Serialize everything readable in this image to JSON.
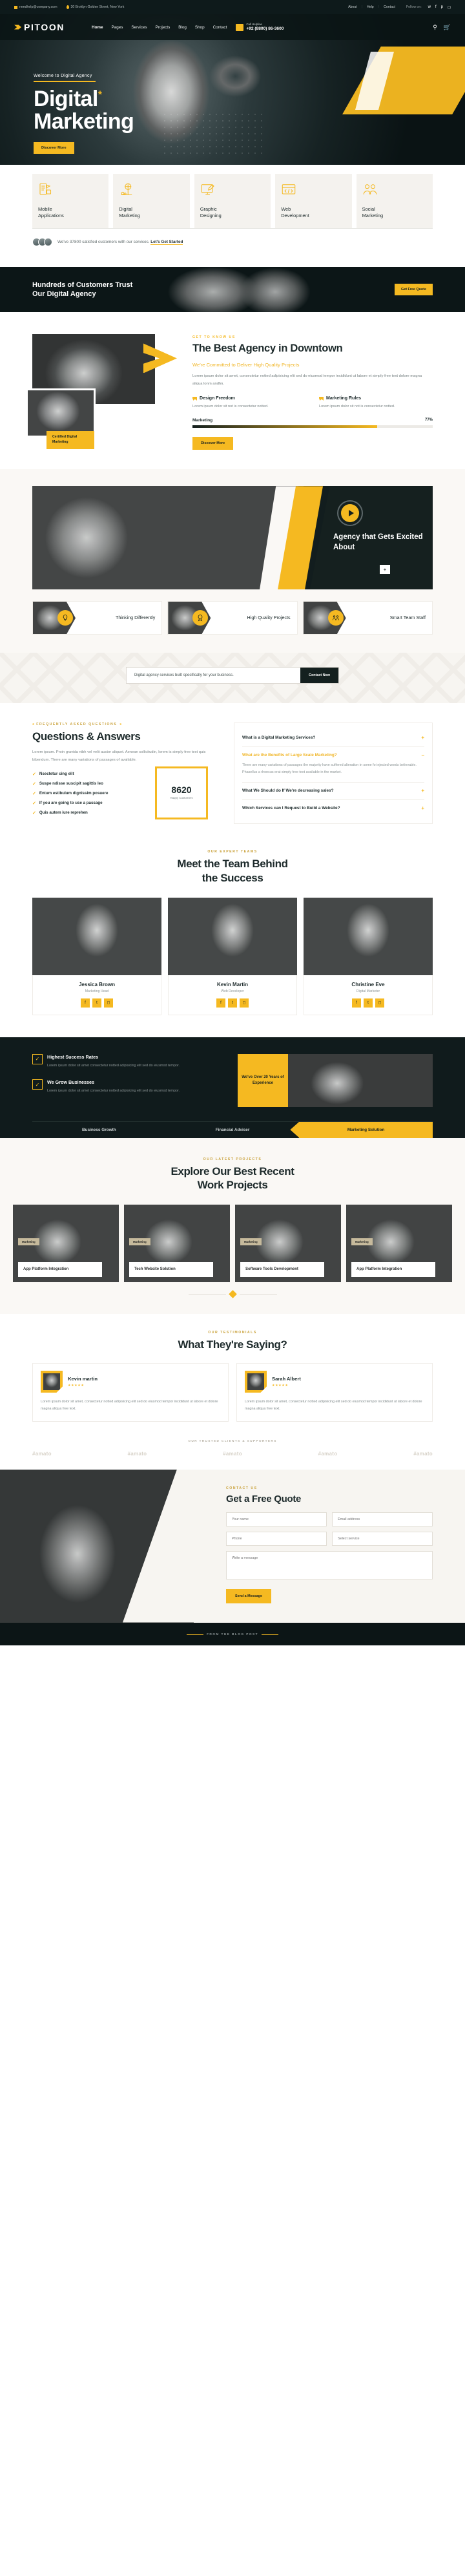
{
  "topbar": {
    "email": "needhelp@company.com",
    "address": "30 Broklyn Golden Street, New York",
    "links": [
      "About",
      "Help",
      "Contact"
    ],
    "follow_label": "Follow on:",
    "socials": [
      "twitter-icon",
      "facebook-icon",
      "pinterest-icon",
      "instagram-icon"
    ]
  },
  "header": {
    "logo": "PITOON",
    "nav": [
      "Home",
      "Pages",
      "Services",
      "Projects",
      "Blog",
      "Shop",
      "Contact"
    ],
    "helpline_label": "Call Helpline",
    "helpline_number": "+92 (8800) 86-3600"
  },
  "hero": {
    "superheading": "Welcome to Digital Agency",
    "title_line1": "Digital",
    "title_line2": "Marketing",
    "star": "*",
    "button": "Discover More"
  },
  "services": [
    {
      "name": "Mobile\nApplications",
      "icon": "mobile-app-icon"
    },
    {
      "name": "Digital\nMarketing",
      "icon": "digital-marketing-icon"
    },
    {
      "name": "Graphic\nDesigning",
      "icon": "graphic-design-icon"
    },
    {
      "name": "Web\nDevelopment",
      "icon": "web-development-icon"
    },
    {
      "name": "Social\nMarketing",
      "icon": "social-marketing-icon"
    }
  ],
  "satisfied": {
    "text": "We've 37800 satisfied customers with our services.",
    "link": "Let's Get Started"
  },
  "trust": {
    "heading": "Hundreds of Customers Trust\nOur Digital Agency",
    "button": "Get Free Quote"
  },
  "agency": {
    "kicker": "GET TO KNOW US",
    "heading": "The Best Agency in Downtown",
    "subheading": "We're Committed to Deliver High Quality Projects",
    "paragraph": "Lorem ipsum dolor sit amet, consectetur notted adipisicing elit sed do eiusmod tempor incididunt ut labore et simply free text dolore magna aliqua lonm andhn.",
    "features": [
      {
        "title": "Design Freedom",
        "text": "Lorem ipsum dolor sit not is consectetur notted."
      },
      {
        "title": "Marketing Rules",
        "text": "Lorem ipsum dolor sit not is consectetur notted."
      }
    ],
    "skill_label": "Marketing",
    "skill_value": "77%",
    "skill_pct": 77,
    "badge": "Certified Digital Marketing",
    "button": "Discover More"
  },
  "video": {
    "heading": "Agency that Gets Excited About",
    "play_icon": "play-icon",
    "plus": "+"
  },
  "features3": [
    {
      "title": "Thinking Differently",
      "icon": "lightbulb-icon"
    },
    {
      "title": "High Quality Projects",
      "icon": "badge-icon"
    },
    {
      "title": "Smart Team Staff",
      "icon": "team-icon"
    }
  ],
  "cta": {
    "text": "Digital agency services built specifically for your business.",
    "button": "Contact Now"
  },
  "faq": {
    "kicker": "FREQUENTLY ASKED QUESTIONS",
    "heading": "Questions & Answers",
    "paragraph": "Lorem ipsum. Proin gravida nibh vel velit auctor aliquet. Aenean sollicitudin, lorem is simply free text quis bibendum. There are many variations of passages of available.",
    "bullets": [
      "Nsectetur cing elit",
      "Suspe ndisse suscipit sagittis leo",
      "Entum estibulum dignissim posuere",
      "If you are going to use a passage",
      "Quis autem iure reprehen"
    ],
    "counter_number": "8620",
    "counter_label": "Happy Customers",
    "items": [
      {
        "q": "What is a Digital Marketing Services?",
        "a": "",
        "open": false
      },
      {
        "q": "What are the Benefits of Large Scale Marketing?",
        "a": "There are many variations of passages the majority have suffered alteration in some fo injected words believable. Phasellus a rhoncus erat simply free text available in the market.",
        "open": true
      },
      {
        "q": "What We Should do If We're decreasing sales?",
        "a": "",
        "open": false
      },
      {
        "q": "Which Services can I Request to Build a Website?",
        "a": "",
        "open": false
      }
    ]
  },
  "team": {
    "kicker": "OUR EXPERT TEAMS",
    "heading": "Meet the Team Behind\nthe Success",
    "members": [
      {
        "name": "Jessica Brown",
        "role": "Marketing Head",
        "socials": [
          "facebook-icon",
          "twitter-icon",
          "instagram-icon"
        ]
      },
      {
        "name": "Kevin Martin",
        "role": "Web Developer",
        "socials": [
          "facebook-icon",
          "twitter-icon",
          "instagram-icon"
        ]
      },
      {
        "name": "Christine Eve",
        "role": "Digital Marketer",
        "socials": [
          "facebook-icon",
          "twitter-icon",
          "instagram-icon"
        ]
      }
    ]
  },
  "success": {
    "items": [
      {
        "title": "Highest Success Rates",
        "text": "Lorem ipsum dolor sit amet consectetur notted adipisicing elit sed do eiusmod tempor."
      },
      {
        "title": "We Grow Businesses",
        "text": "Lorem ipsum dolor sit amet consectetur notted adipisicing elit sed do eiusmod tempor."
      }
    ],
    "badge": "We've Over 20 Years of Experience",
    "tabs": [
      "Business Growth",
      "Financial Adviser",
      "Marketing Solution"
    ],
    "active_tab": "Marketing Solution"
  },
  "projects": {
    "kicker": "OUR LATEST PROJECTS",
    "heading": "Explore Our Best Recent\nWork Projects",
    "items": [
      {
        "tag": "Marketing",
        "title": "App Platform Integration"
      },
      {
        "tag": "Marketing",
        "title": "Tech Website Solution"
      },
      {
        "tag": "Marketing",
        "title": "Software Tools Development"
      },
      {
        "tag": "Marketing",
        "title": "App Platform Integration"
      }
    ]
  },
  "testimonials": {
    "kicker": "OUR TESTIMONIALS",
    "heading": "What They're Saying?",
    "items": [
      {
        "name": "Kevin martin",
        "stars": "★★★★★",
        "text": "Lorem ipsum dolor sit amet, consectetur notted adipisicing elit sed do eiusmod tempor incididunt ut labore et dolore magna aliqua free text."
      },
      {
        "name": "Sarah Albert",
        "stars": "★★★★★",
        "text": "Lorem ipsum dolor sit amet, consectetur notted adipisicing elit sed do eiusmod tempor incididunt ut labore et dolore magna aliqua free text."
      }
    ]
  },
  "brands": {
    "kicker": "OUR TRUSTED CLIENTS & SUPPORTERS",
    "items": [
      "#amato",
      "#amato",
      "#amato",
      "#amato",
      "#amato"
    ]
  },
  "contact": {
    "kicker": "CONTACT US",
    "heading": "Get a Free Quote",
    "fields": {
      "name": "Your name",
      "email": "Email address",
      "phone": "Phone",
      "subject": "Select service",
      "message": "Write a message"
    },
    "button": "Send a Message"
  },
  "footer": {
    "kicker": "FROM THE BLOG POST"
  },
  "colors": {
    "accent": "#f5b921",
    "dark": "#101b1c",
    "cream": "#f7f5f1"
  }
}
